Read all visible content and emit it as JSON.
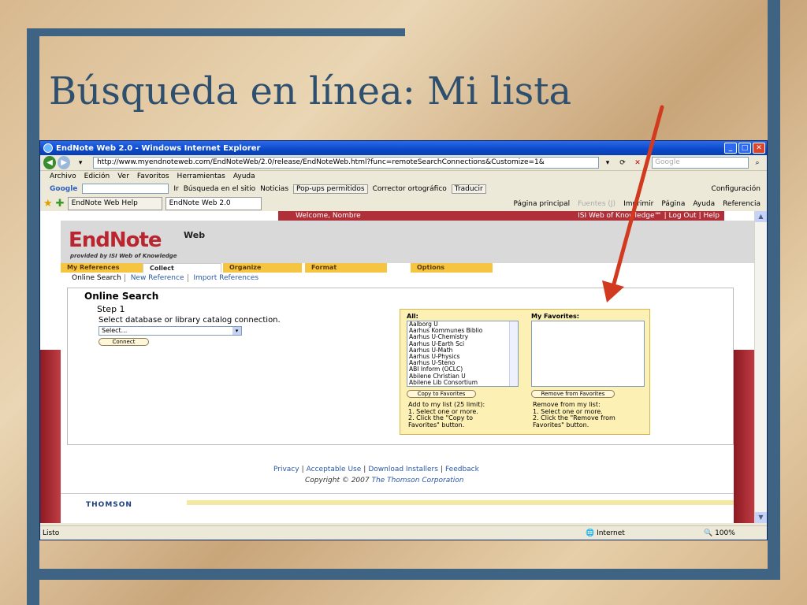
{
  "slide": {
    "title": "Búsqueda en línea: Mi lista"
  },
  "browser": {
    "window_title": "EndNote Web 2.0 - Windows Internet Explorer",
    "url": "http://www.myendnoteweb.com/EndNoteWeb/2.0/release/EndNoteWeb.html?func=remoteSearchConnections&Customize=1&",
    "search_placeholder": "Google",
    "menu": [
      "Archivo",
      "Edición",
      "Ver",
      "Favoritos",
      "Herramientas",
      "Ayuda"
    ],
    "google_toolbar": {
      "brand": "Google",
      "items": [
        "Ir",
        "Búsqueda en el sitio",
        "Noticias",
        "Pop-ups permitidos",
        "Corrector ortográfico",
        "Traducir"
      ],
      "settings": "Configuración"
    },
    "tabs": [
      "EndNote Web Help",
      "EndNote Web 2.0"
    ],
    "commands": {
      "home": "Página principal",
      "feeds": "Fuentes (J)",
      "print": "Imprimir",
      "page": "Página",
      "help": "Ayuda",
      "reference": "Referencia"
    },
    "status": {
      "left": "Listo",
      "zone": "Internet",
      "zoom": "100%"
    }
  },
  "site": {
    "welcome": "Welcome, Nombre",
    "top_links": "ISI Web of Knowledge℠ | Log Out | Help",
    "logo": {
      "main": "EndNote",
      "suffix": "Web",
      "tagline": "provided by ISI Web of Knowledge"
    },
    "app_tabs": [
      "My References",
      "Collect",
      "Organize",
      "Format",
      "Options"
    ],
    "sub_tabs": [
      "Online Search",
      "New Reference",
      "Import References"
    ],
    "online_search": {
      "heading": "Online Search",
      "step": "Step 1",
      "instruction": "Select database or library catalog connection.",
      "select_value": "Select...",
      "connect_label": "Connect",
      "all_label": "All:",
      "favorites_label": "My Favorites:",
      "all_items": [
        "Aalborg U",
        "Aarhus Kommunes Biblio",
        "Aarhus U-Chemistry",
        "Aarhus U-Earth Sci",
        "Aarhus U-Math",
        "Aarhus U-Physics",
        "Aarhus U-Steno",
        "ABI Inform (OCLC)",
        "Abilene Christian U",
        "Abilene Lib Consortium"
      ],
      "copy_label": "Copy to Favorites",
      "remove_label": "Remove from Favorites",
      "add_instructions": [
        "Add to my list (25 limit):",
        "1. Select one or more.",
        "2. Click the \"Copy to",
        "Favorites\" button."
      ],
      "remove_instructions": [
        "Remove from my list:",
        "1. Select one or more.",
        "2. Click the \"Remove from",
        "Favorites\" button."
      ]
    },
    "footer_links": [
      "Privacy",
      "Acceptable Use",
      "Download Installers",
      "Feedback"
    ],
    "copyright_prefix": "Copyright © 2007",
    "copyright_corp": "The Thomson Corporation",
    "footer_logo": "THOMSON"
  },
  "colors": {
    "slide_frame": "#3e6383",
    "annotation_arrow": "#d23a1f",
    "endnote_red": "#b9262f",
    "tab_yellow": "#f5c542"
  }
}
